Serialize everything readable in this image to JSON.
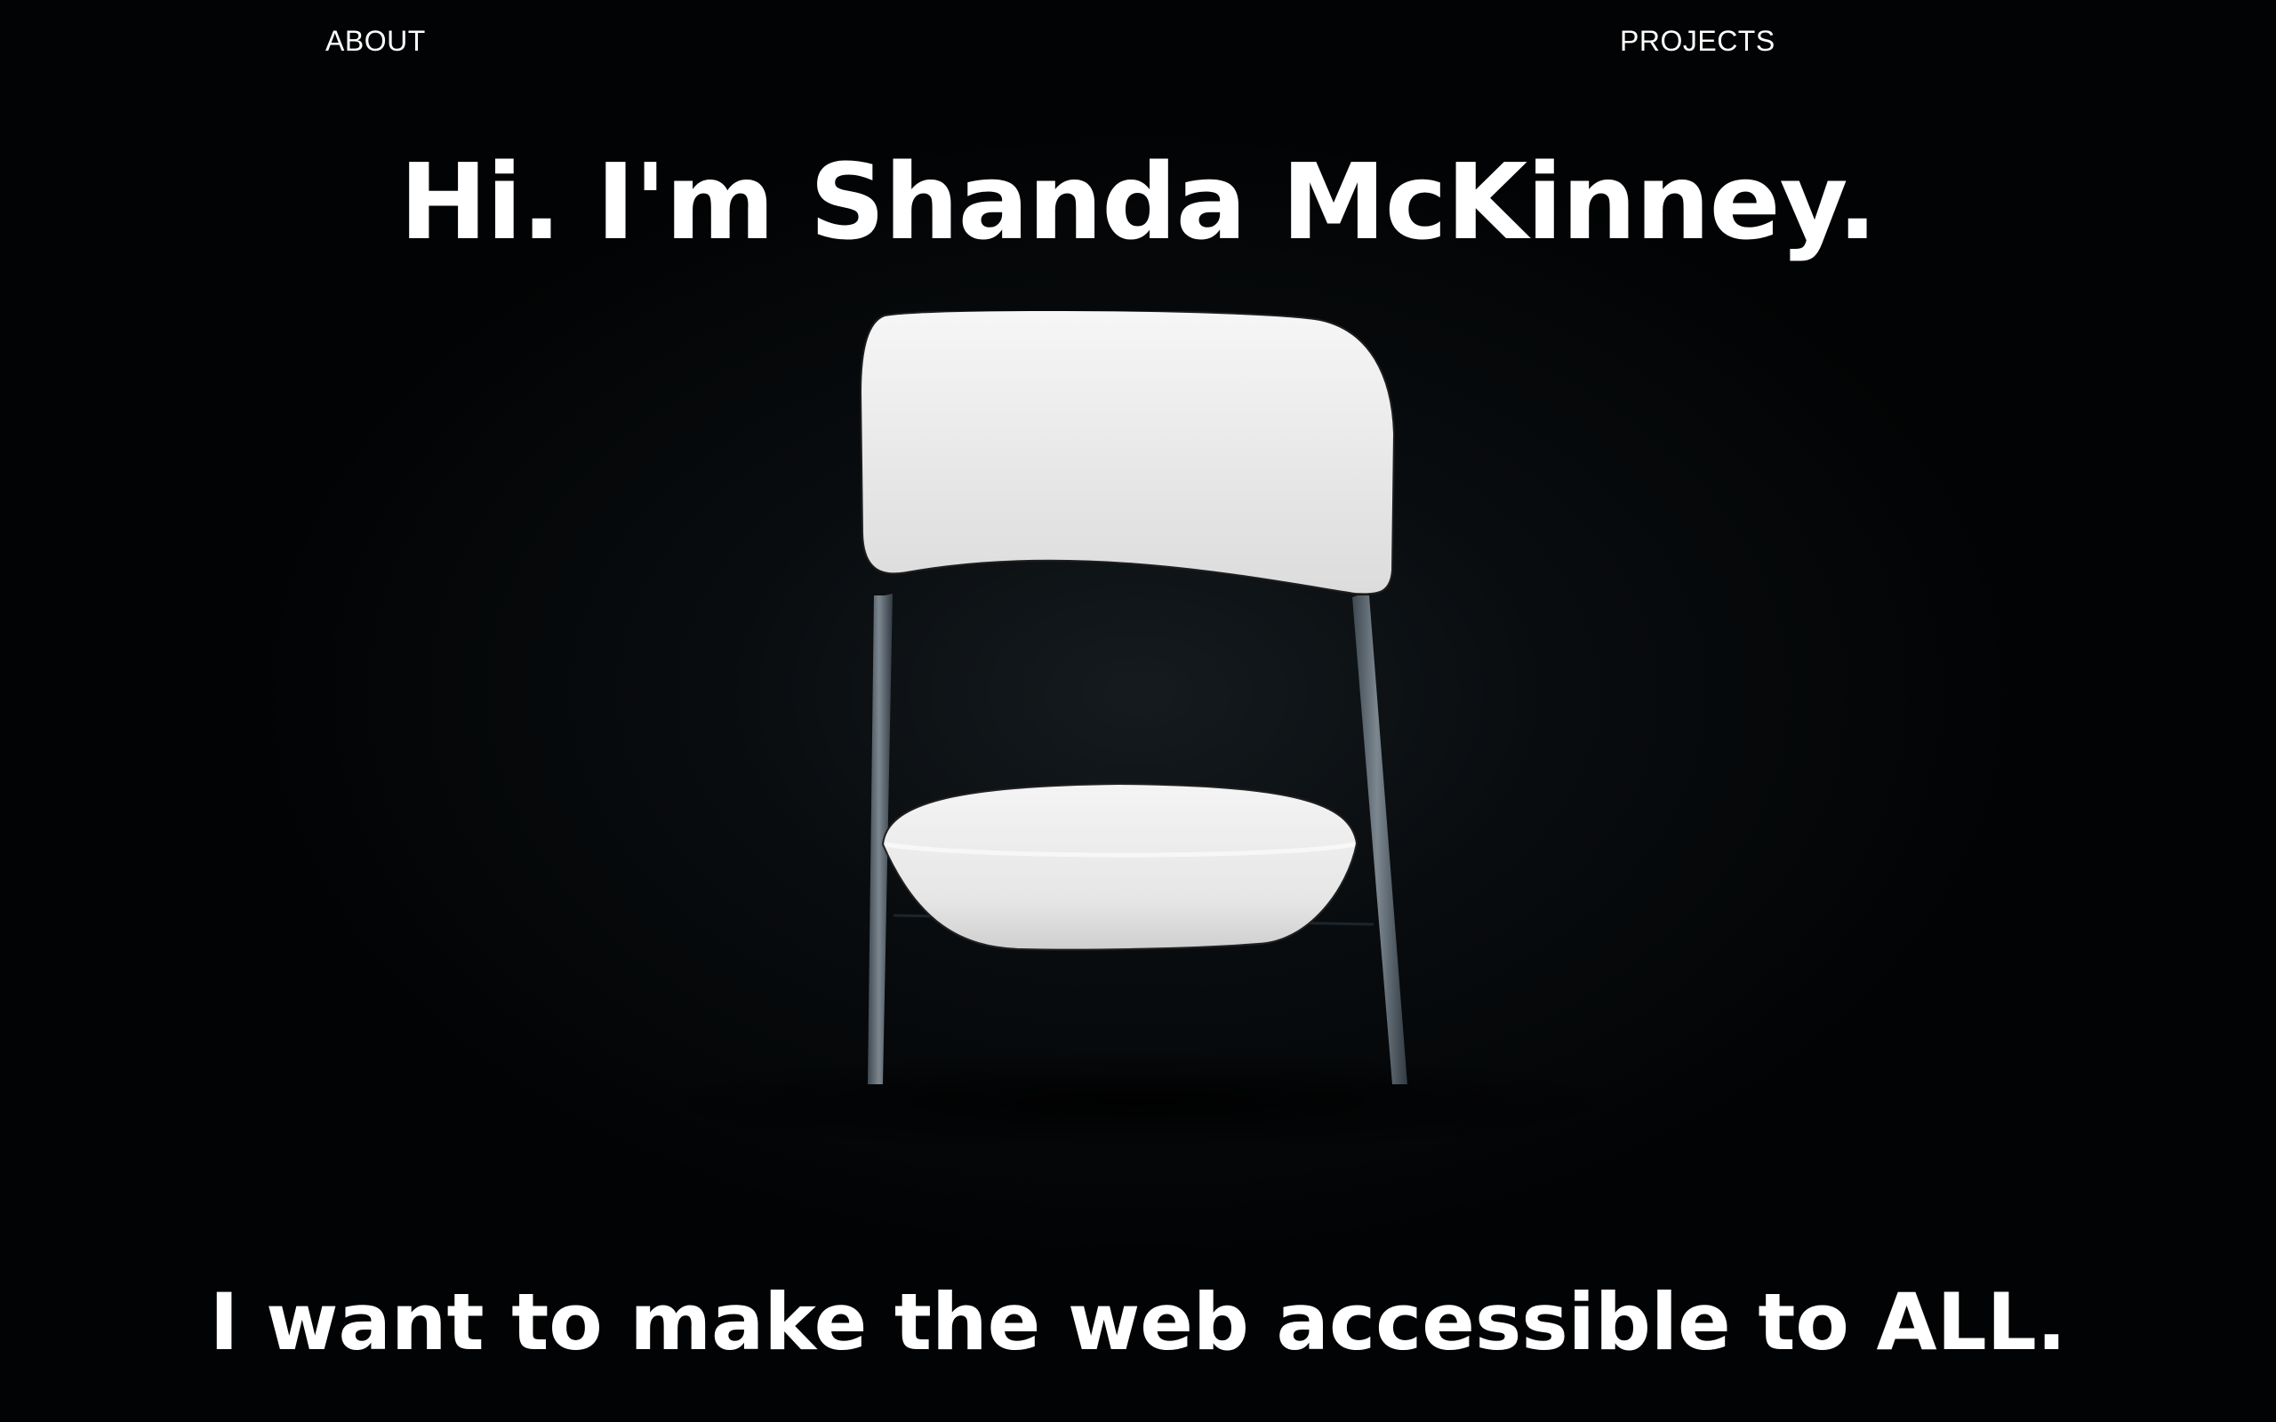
{
  "nav": {
    "about_label": "ABOUT",
    "projects_label": "PROJECTS"
  },
  "hero": {
    "title": "Hi. I'm Shanda McKinney.",
    "tagline": "I want to make the web accessible to ALL."
  },
  "image": {
    "icon": "white-chair-image"
  },
  "colors": {
    "background": "#000000",
    "text": "#ffffff",
    "chair": "#f2f2f2",
    "legs": "#5f6a72"
  }
}
